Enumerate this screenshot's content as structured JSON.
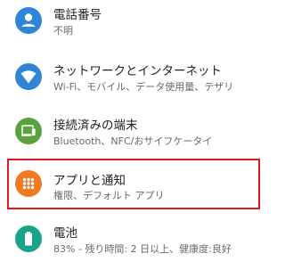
{
  "settings_list": {
    "items": [
      {
        "title": "電話番号",
        "subtitle": "不明",
        "icon": "account-icon",
        "icon_color": "#2f86d6"
      },
      {
        "title": "ネットワークとインターネット",
        "subtitle": "Wi-Fi、モバイル、データ使用量、テザリ",
        "icon": "wifi-icon",
        "icon_color": "#2f86d6"
      },
      {
        "title": "接続済みの端末",
        "subtitle": "Bluetooth、NFC/おサイフケータイ",
        "icon": "connected-devices-icon",
        "icon_color": "#5aa23f"
      },
      {
        "title": "アプリと通知",
        "subtitle": "権限、デフォルト アプリ",
        "icon": "apps-grid-icon",
        "icon_color": "#ef7a22"
      },
      {
        "title": "電池",
        "subtitle": "83% - 残り時間: 2 日以上、健康度:良好",
        "icon": "battery-icon",
        "icon_color": "#1aa388"
      }
    ]
  },
  "highlight": {
    "color": "#e01a1a"
  }
}
